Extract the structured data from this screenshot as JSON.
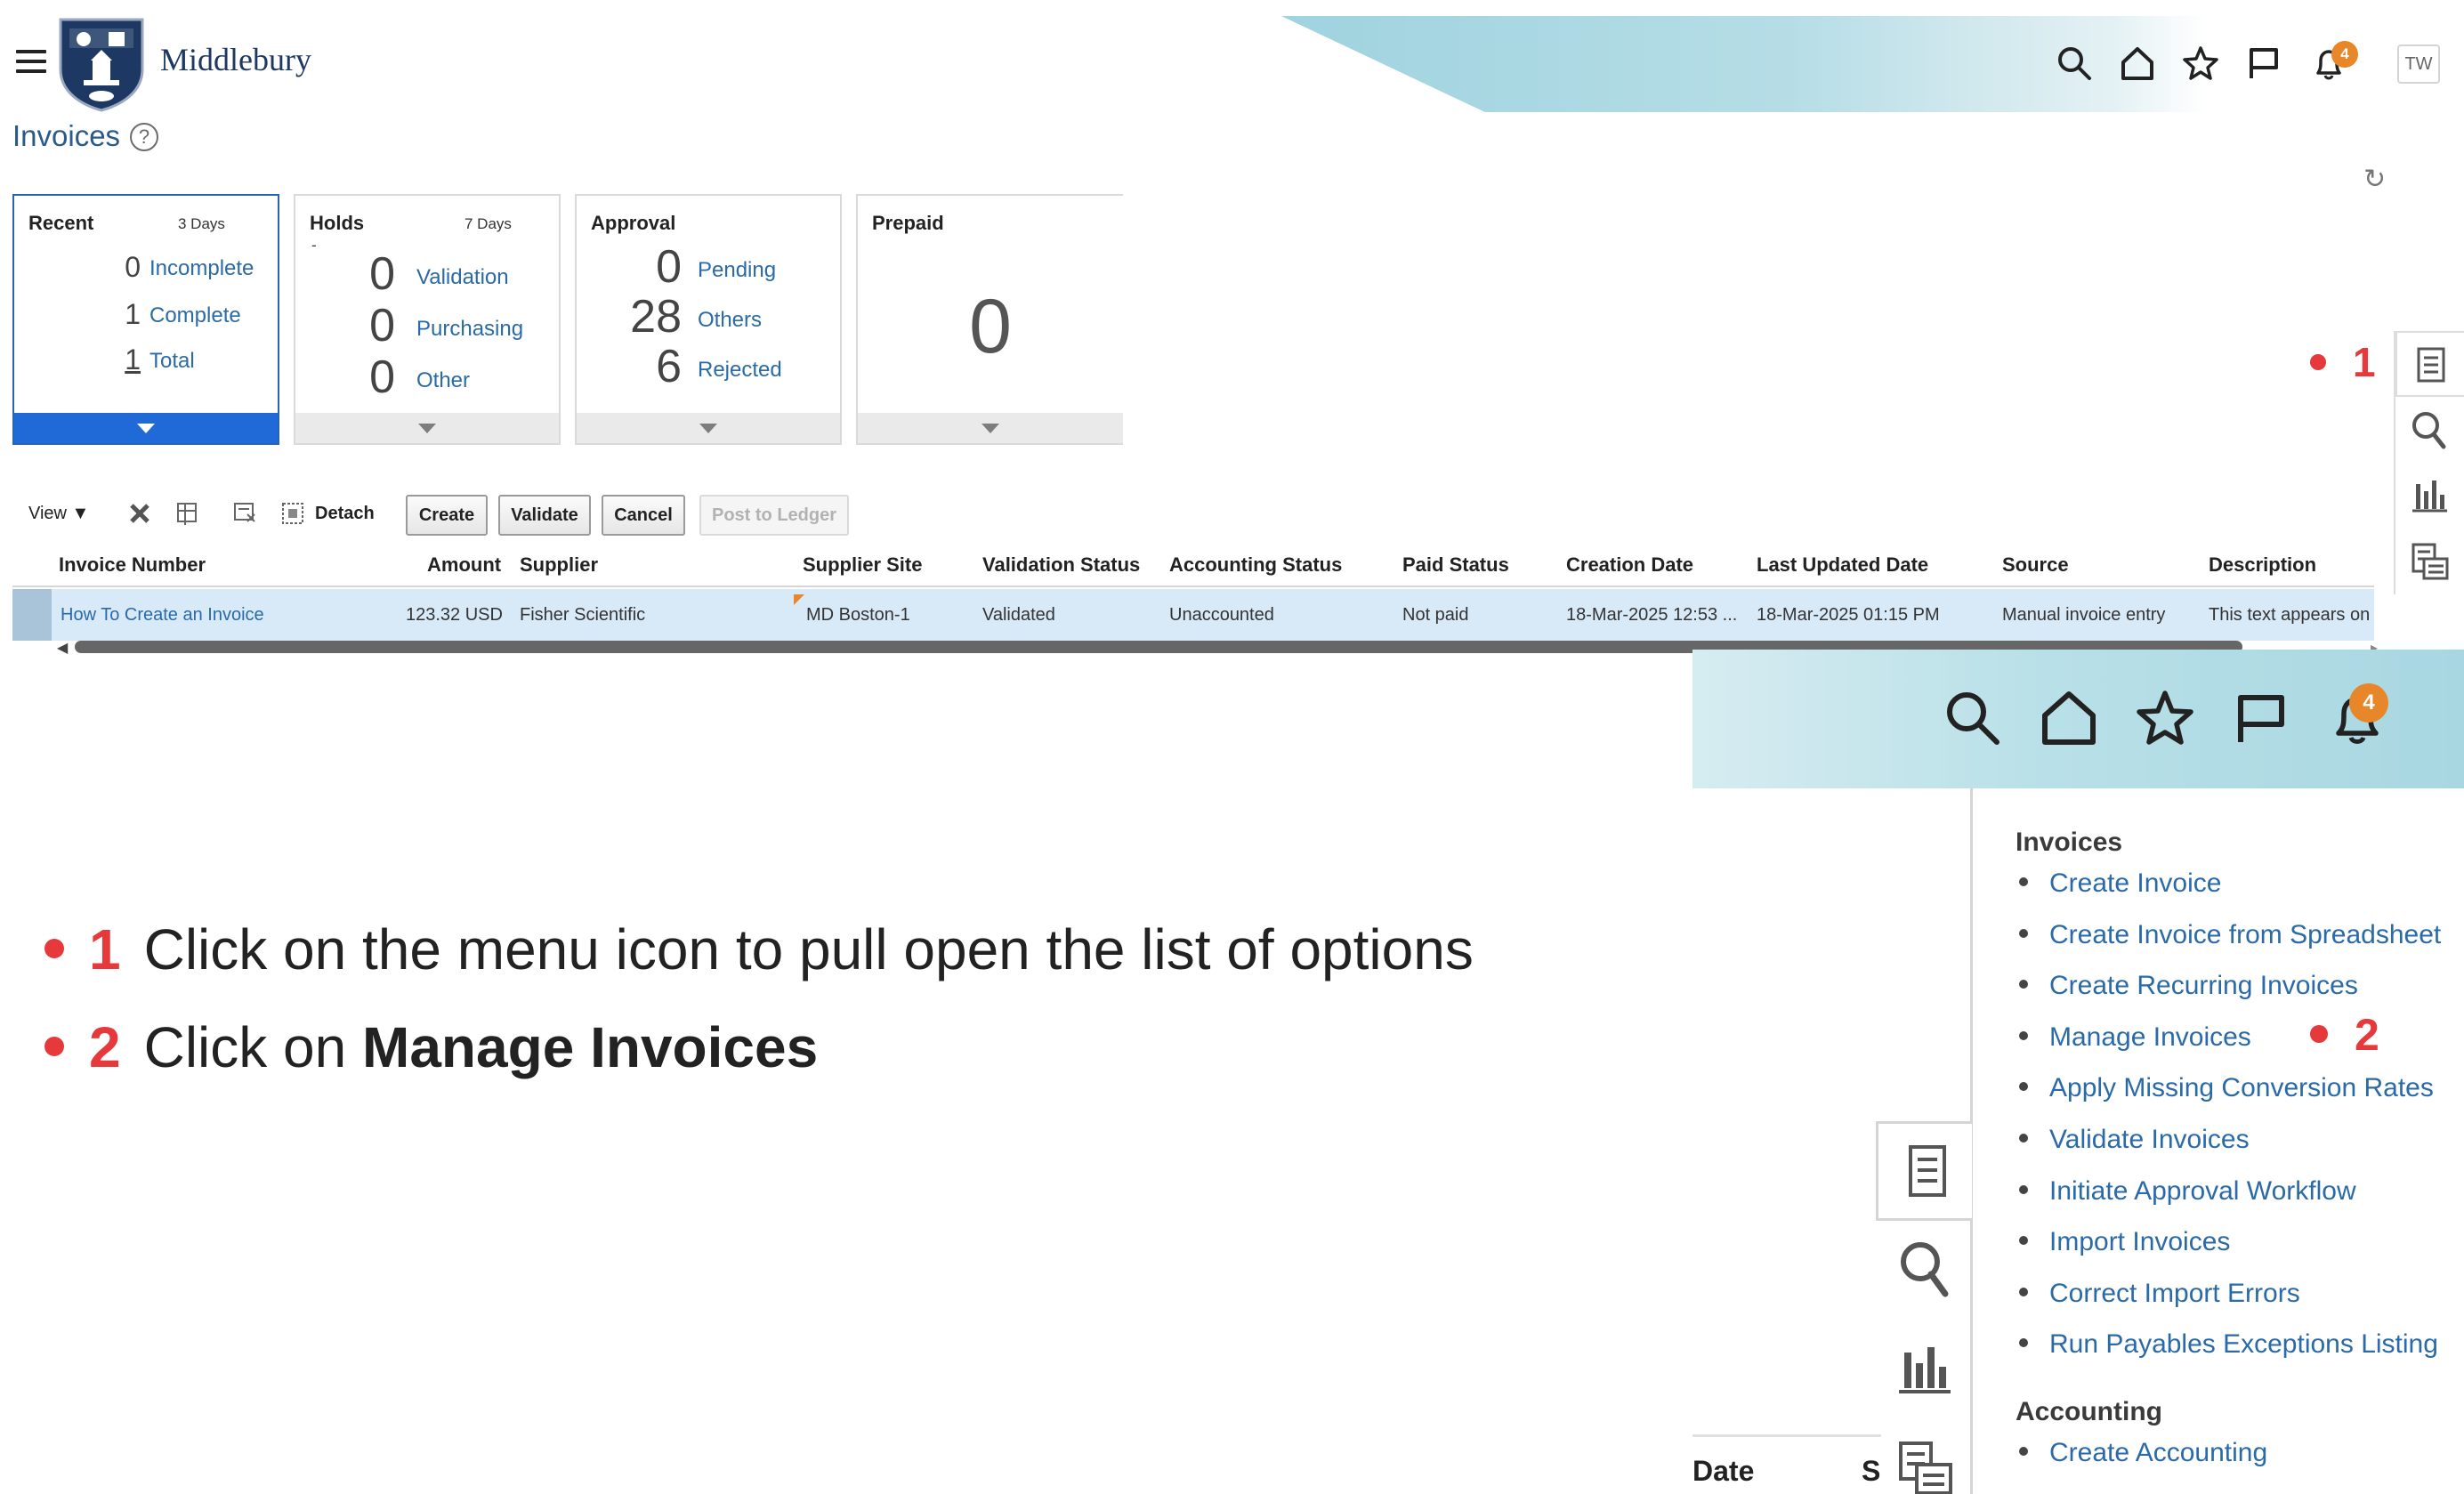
{
  "header": {
    "brand": "Middlebury",
    "avatar": "TW",
    "notification_count": "4",
    "icons": [
      "search-icon",
      "home-icon",
      "star-icon",
      "flag-icon",
      "bell-icon"
    ]
  },
  "page": {
    "title": "Invoices",
    "help": "?"
  },
  "tiles": {
    "recent": {
      "title": "Recent",
      "period": "3 Days",
      "rows": [
        {
          "value": "0",
          "label": "Incomplete"
        },
        {
          "value": "1",
          "label": "Complete"
        },
        {
          "value": "1",
          "label": "Total"
        }
      ]
    },
    "holds": {
      "title": "Holds",
      "period": "7 Days",
      "dash": "-",
      "rows": [
        {
          "value": "0",
          "label": "Validation"
        },
        {
          "value": "0",
          "label": "Purchasing"
        },
        {
          "value": "0",
          "label": "Other"
        }
      ]
    },
    "approval": {
      "title": "Approval",
      "rows": [
        {
          "value": "0",
          "label": "Pending"
        },
        {
          "value": "28",
          "label": "Others"
        },
        {
          "value": "6",
          "label": "Rejected"
        }
      ]
    },
    "prepaid": {
      "title": "Prepaid",
      "value": "0"
    }
  },
  "toolbar": {
    "view_label": "View",
    "detach_label": "Detach",
    "create_label": "Create",
    "validate_label": "Validate",
    "cancel_label": "Cancel",
    "post_label": "Post to Ledger"
  },
  "table": {
    "columns": [
      "Invoice Number",
      "Amount",
      "Supplier",
      "Supplier Site",
      "Validation Status",
      "Accounting Status",
      "Paid Status",
      "Creation Date",
      "Last Updated Date",
      "Source",
      "Description"
    ],
    "rows": [
      {
        "invoice_number": "How To Create an Invoice",
        "amount": "123.32 USD",
        "supplier": "Fisher Scientific",
        "supplier_site": "MD Boston-1",
        "validation_status": "Validated",
        "accounting_status": "Unaccounted",
        "paid_status": "Not paid",
        "creation_date": "18-Mar-2025 12:53 ...",
        "last_updated_date": "18-Mar-2025 01:15 PM",
        "source": "Manual invoice entry",
        "description": "This text appears on th"
      }
    ]
  },
  "callouts": {
    "one": "1",
    "two": "2"
  },
  "zoom_menu": {
    "sections": [
      {
        "heading": "Invoices",
        "items": [
          "Create Invoice",
          "Create Invoice from Spreadsheet",
          "Create Recurring Invoices",
          "Manage Invoices",
          "Apply Missing Conversion Rates",
          "Validate Invoices",
          "Initiate Approval Workflow",
          "Import Invoices",
          "Correct Import Errors",
          "Run Payables Exceptions Listing"
        ]
      },
      {
        "heading": "Accounting",
        "items": [
          "Create Accounting"
        ]
      }
    ],
    "behind_text_1": "Date",
    "behind_text_2": "S"
  },
  "instructions": {
    "step1_num": "1",
    "step1_text": "Click on the menu icon to pull open the list of options",
    "step2_num": "2",
    "step2_prefix": "Click on",
    "step2_bold": "Manage Invoices"
  },
  "colors": {
    "accent": "#2a6aa8",
    "selected_tile": "#1f6ad6",
    "badge": "#e8862a",
    "callout": "#e5393b",
    "row_selected": "#d8eaf8"
  }
}
